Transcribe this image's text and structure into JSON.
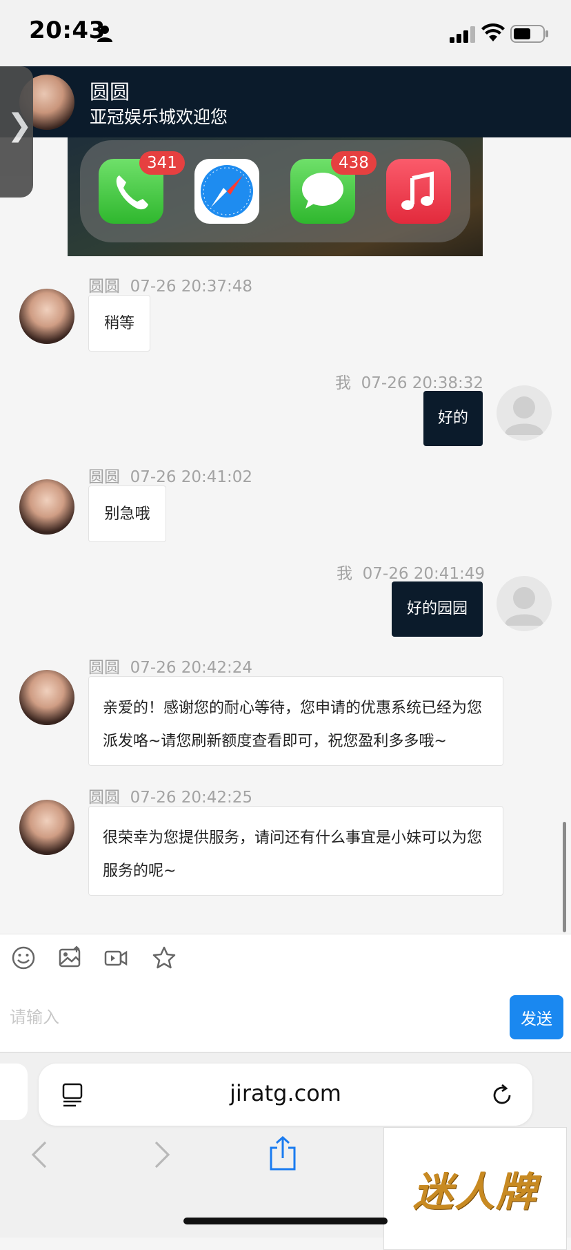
{
  "status_bar": {
    "time": "20:43"
  },
  "header": {
    "name": "圆圆",
    "subtitle": "亚冠娱乐城欢迎您"
  },
  "shared_image": {
    "badges": {
      "phone": "341",
      "messages": "438"
    }
  },
  "messages": [
    {
      "sender": "圆圆",
      "time": "07-26 20:37:48",
      "text": "稍等"
    },
    {
      "sender": "我",
      "time": "07-26 20:38:32",
      "text": "好的"
    },
    {
      "sender": "圆圆",
      "time": "07-26 20:41:02",
      "text": "别急哦"
    },
    {
      "sender": "我",
      "time": "07-26 20:41:49",
      "text": "好的园园"
    },
    {
      "sender": "圆圆",
      "time": "07-26 20:42:24",
      "text": "亲爱的！感谢您的耐心等待，您申请的优惠系统已经为您派发咯~请您刷新额度查看即可，祝您盈利多多哦~"
    },
    {
      "sender": "圆圆",
      "time": "07-26 20:42:25",
      "text": "很荣幸为您提供服务，请问还有什么事宜是小妹可以为您服务的呢~"
    }
  ],
  "composer": {
    "placeholder": "请输入",
    "send_label": "发送"
  },
  "browser": {
    "url": "jiratg.com"
  },
  "ad": {
    "text": "迷人牌"
  }
}
